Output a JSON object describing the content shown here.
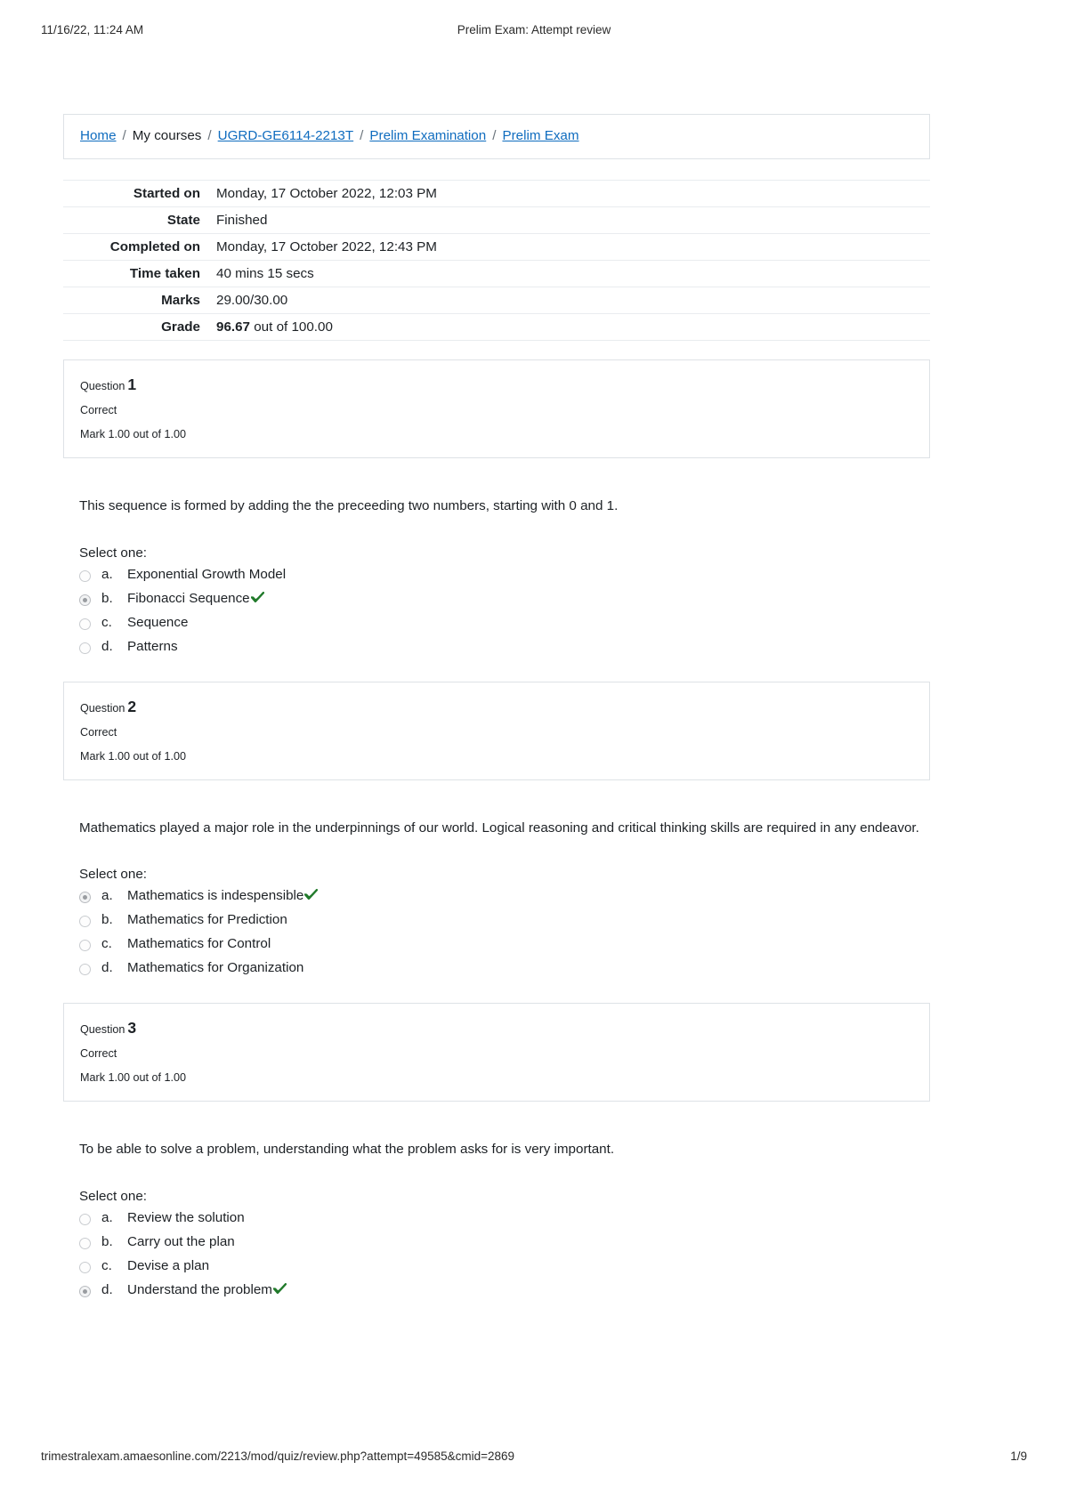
{
  "print_header": {
    "date": "11/16/22, 11:24 AM",
    "title": "Prelim Exam: Attempt review"
  },
  "print_footer": {
    "url": "trimestralexam.amaesonline.com/2213/mod/quiz/review.php?attempt=49585&cmid=2869",
    "page": "1/9"
  },
  "breadcrumb": {
    "items": [
      {
        "label": "Home",
        "link": true
      },
      {
        "label": "My courses",
        "link": false
      },
      {
        "label": "UGRD-GE6114-2213T",
        "link": true
      },
      {
        "label": "Prelim Examination",
        "link": true
      },
      {
        "label": "Prelim Exam",
        "link": true
      }
    ],
    "separator": "/"
  },
  "summary": {
    "rows": [
      {
        "label": "Started on",
        "value": "Monday, 17 October 2022, 12:03 PM"
      },
      {
        "label": "State",
        "value": "Finished"
      },
      {
        "label": "Completed on",
        "value": "Monday, 17 October 2022, 12:43 PM"
      },
      {
        "label": "Time taken",
        "value": "40 mins 15 secs"
      },
      {
        "label": "Marks",
        "value": "29.00/30.00"
      }
    ],
    "grade_label": "Grade",
    "grade_value": "96.67",
    "grade_suffix": " out of 100.00"
  },
  "questions": [
    {
      "q_word": "Question",
      "number": "1",
      "state": "Correct",
      "mark": "Mark 1.00 out of 1.00",
      "text": "This sequence is formed by adding the the preceeding two numbers, starting with 0 and 1.",
      "select_label": "Select one:",
      "options": [
        {
          "letter": "a.",
          "text": "Exponential Growth Model",
          "selected": false,
          "correct": false
        },
        {
          "letter": "b.",
          "text": "Fibonacci Sequence",
          "selected": true,
          "correct": true
        },
        {
          "letter": "c.",
          "text": "Sequence",
          "selected": false,
          "correct": false
        },
        {
          "letter": "d.",
          "text": "Patterns",
          "selected": false,
          "correct": false
        }
      ]
    },
    {
      "q_word": "Question",
      "number": "2",
      "state": "Correct",
      "mark": "Mark 1.00 out of 1.00",
      "text": "Mathematics played a major role in the underpinnings of our world. Logical reasoning and critical thinking skills are required in any endeavor.",
      "select_label": "Select one:",
      "options": [
        {
          "letter": "a.",
          "text": "Mathematics is indespensible",
          "selected": true,
          "correct": true
        },
        {
          "letter": "b.",
          "text": "Mathematics for Prediction",
          "selected": false,
          "correct": false
        },
        {
          "letter": "c.",
          "text": "Mathematics for Control",
          "selected": false,
          "correct": false
        },
        {
          "letter": "d.",
          "text": "Mathematics for Organization",
          "selected": false,
          "correct": false
        }
      ]
    },
    {
      "q_word": "Question",
      "number": "3",
      "state": "Correct",
      "mark": "Mark 1.00 out of 1.00",
      "text": "To be able to solve a problem, understanding what the problem asks for is very important.",
      "select_label": "Select one:",
      "options": [
        {
          "letter": "a.",
          "text": "Review the solution",
          "selected": false,
          "correct": false
        },
        {
          "letter": "b.",
          "text": "Carry out the plan",
          "selected": false,
          "correct": false
        },
        {
          "letter": "c.",
          "text": "Devise a plan",
          "selected": false,
          "correct": false
        },
        {
          "letter": "d.",
          "text": "Understand the problem",
          "selected": true,
          "correct": true
        }
      ]
    }
  ],
  "colors": {
    "link": "#0f6cbf",
    "correct_tick": "#217a2b",
    "border": "#dee2e6"
  }
}
